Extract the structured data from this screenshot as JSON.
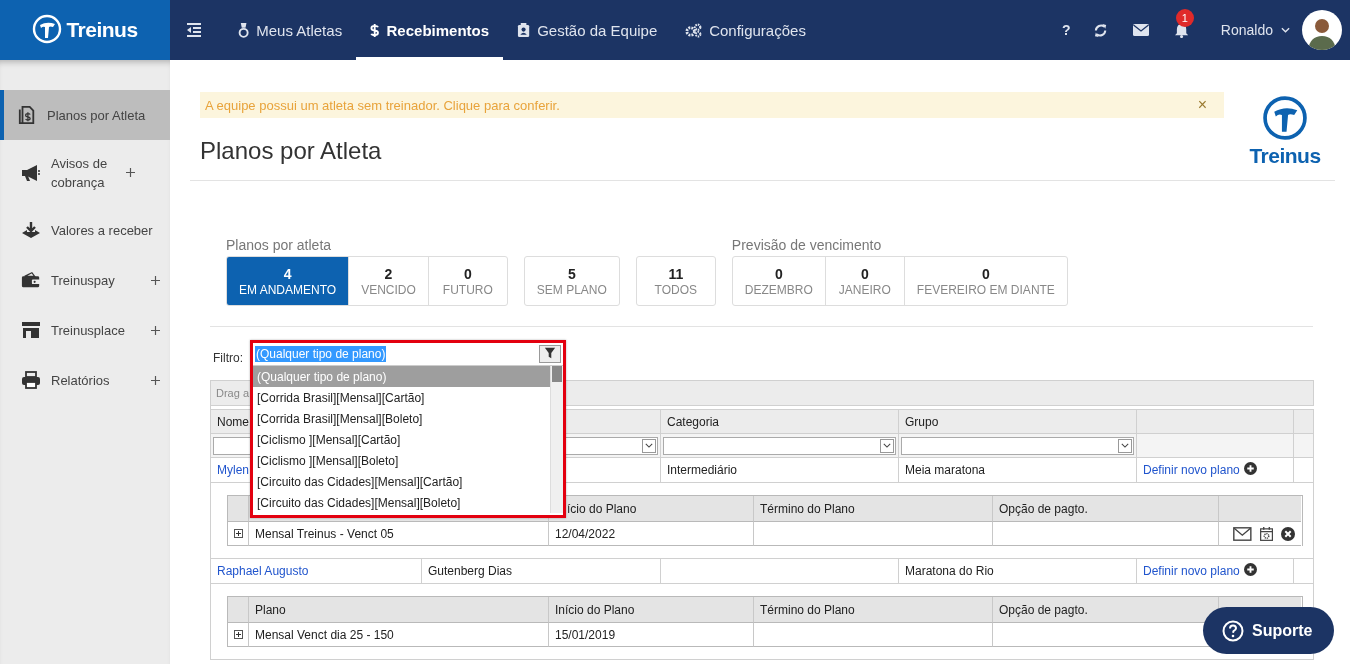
{
  "topbar": {
    "logo": "Treinus",
    "nav": [
      {
        "label": "Meus Atletas",
        "selected": false
      },
      {
        "label": "Recebimentos",
        "selected": true
      },
      {
        "label": "Gestão da Equipe",
        "selected": false
      },
      {
        "label": "Configurações",
        "selected": false
      }
    ],
    "help": "?",
    "notifications": "1",
    "user": "Ronaldo"
  },
  "sidebar": {
    "items": [
      {
        "label": "Planos por Atleta",
        "selected": true,
        "expandable": false
      },
      {
        "label": "Avisos de cobrança",
        "selected": false,
        "expandable": true
      },
      {
        "label": "Valores a receber",
        "selected": false,
        "expandable": false
      },
      {
        "label": "Treinuspay",
        "selected": false,
        "expandable": true
      },
      {
        "label": "Treinusplace",
        "selected": false,
        "expandable": true
      },
      {
        "label": "Relatórios",
        "selected": false,
        "expandable": true
      }
    ]
  },
  "main": {
    "alert": {
      "text": "A equipe possui um atleta sem treinador. Clique para conferir.",
      "close": "×"
    },
    "title": "Planos por Atleta",
    "logo": "Treinus",
    "stats": [
      {
        "label": "Planos por atleta",
        "buttons": [
          {
            "count": "4",
            "label": "EM ANDAMENTO",
            "selected": true
          },
          {
            "count": "2",
            "label": "VENCIDO",
            "selected": false
          },
          {
            "count": "0",
            "label": "FUTURO",
            "selected": false
          }
        ]
      },
      {
        "buttons": [
          {
            "count": "5",
            "label": "SEM PLANO",
            "selected": false
          }
        ]
      },
      {
        "buttons": [
          {
            "count": "11",
            "label": "TODOS",
            "selected": false
          }
        ]
      },
      {
        "label": "Previsão de vencimento",
        "buttons": [
          {
            "count": "0",
            "label": "DEZEMBRO",
            "selected": false
          },
          {
            "count": "0",
            "label": "JANEIRO",
            "selected": false
          },
          {
            "count": "0",
            "label": "FEVEREIRO EM DIANTE",
            "selected": false
          }
        ]
      }
    ],
    "filter": {
      "label": "Filtro:",
      "value": "(Qualquer tipo de plano)",
      "options": [
        {
          "label": "(Qualquer tipo de plano)",
          "selected": true
        },
        {
          "label": "[Corrida Brasil][Mensal][Cartão]",
          "selected": false
        },
        {
          "label": "[Corrida Brasil][Mensal][Boleto]",
          "selected": false
        },
        {
          "label": "[Ciclismo ][Mensal][Cartão]",
          "selected": false
        },
        {
          "label": "[Ciclismo ][Mensal][Boleto]",
          "selected": false
        },
        {
          "label": "[Circuito das Cidades][Mensal][Cartão]",
          "selected": false
        },
        {
          "label": "[Circuito das Cidades][Mensal][Boleto]",
          "selected": false
        }
      ]
    },
    "grid": {
      "group_panel": "Drag a",
      "columns": {
        "column_1": "Nome",
        "column_3": "Categoria",
        "column_4": "Grupo"
      },
      "rows": [
        {
          "cells": {
            "column_1": "Mylen",
            "column_3": "Intermediário",
            "column_4": "Meia maratona"
          },
          "link": "Definir novo plano",
          "detail": {
            "columns": {
              "column_3": "ício do Plano",
              "column_4": "Término do Plano",
              "column_5": "Opção de pagto."
            },
            "rows": [
              {
                "cells": {
                  "column_2": "Mensal Treinus - Venct 05",
                  "column_3": "12/04/2022"
                },
                "actions": true
              }
            ]
          }
        },
        {
          "cells": {
            "column_1": "Raphael Augusto",
            "column_2": "Gutenberg Dias",
            "column_4": "Maratona do Rio"
          },
          "link": "Definir novo plano",
          "detail": {
            "columns": {
              "column_2": "Plano",
              "column_3": "Início do Plano",
              "column_4": "Término do Plano",
              "column_5": "Opção de pagto."
            },
            "rows": [
              {
                "cells": {
                  "column_2": "Mensal Venct dia 25 - 150",
                  "column_3": "15/01/2019"
                }
              }
            ]
          }
        }
      ]
    }
  },
  "support": {
    "label": "Suporte"
  }
}
